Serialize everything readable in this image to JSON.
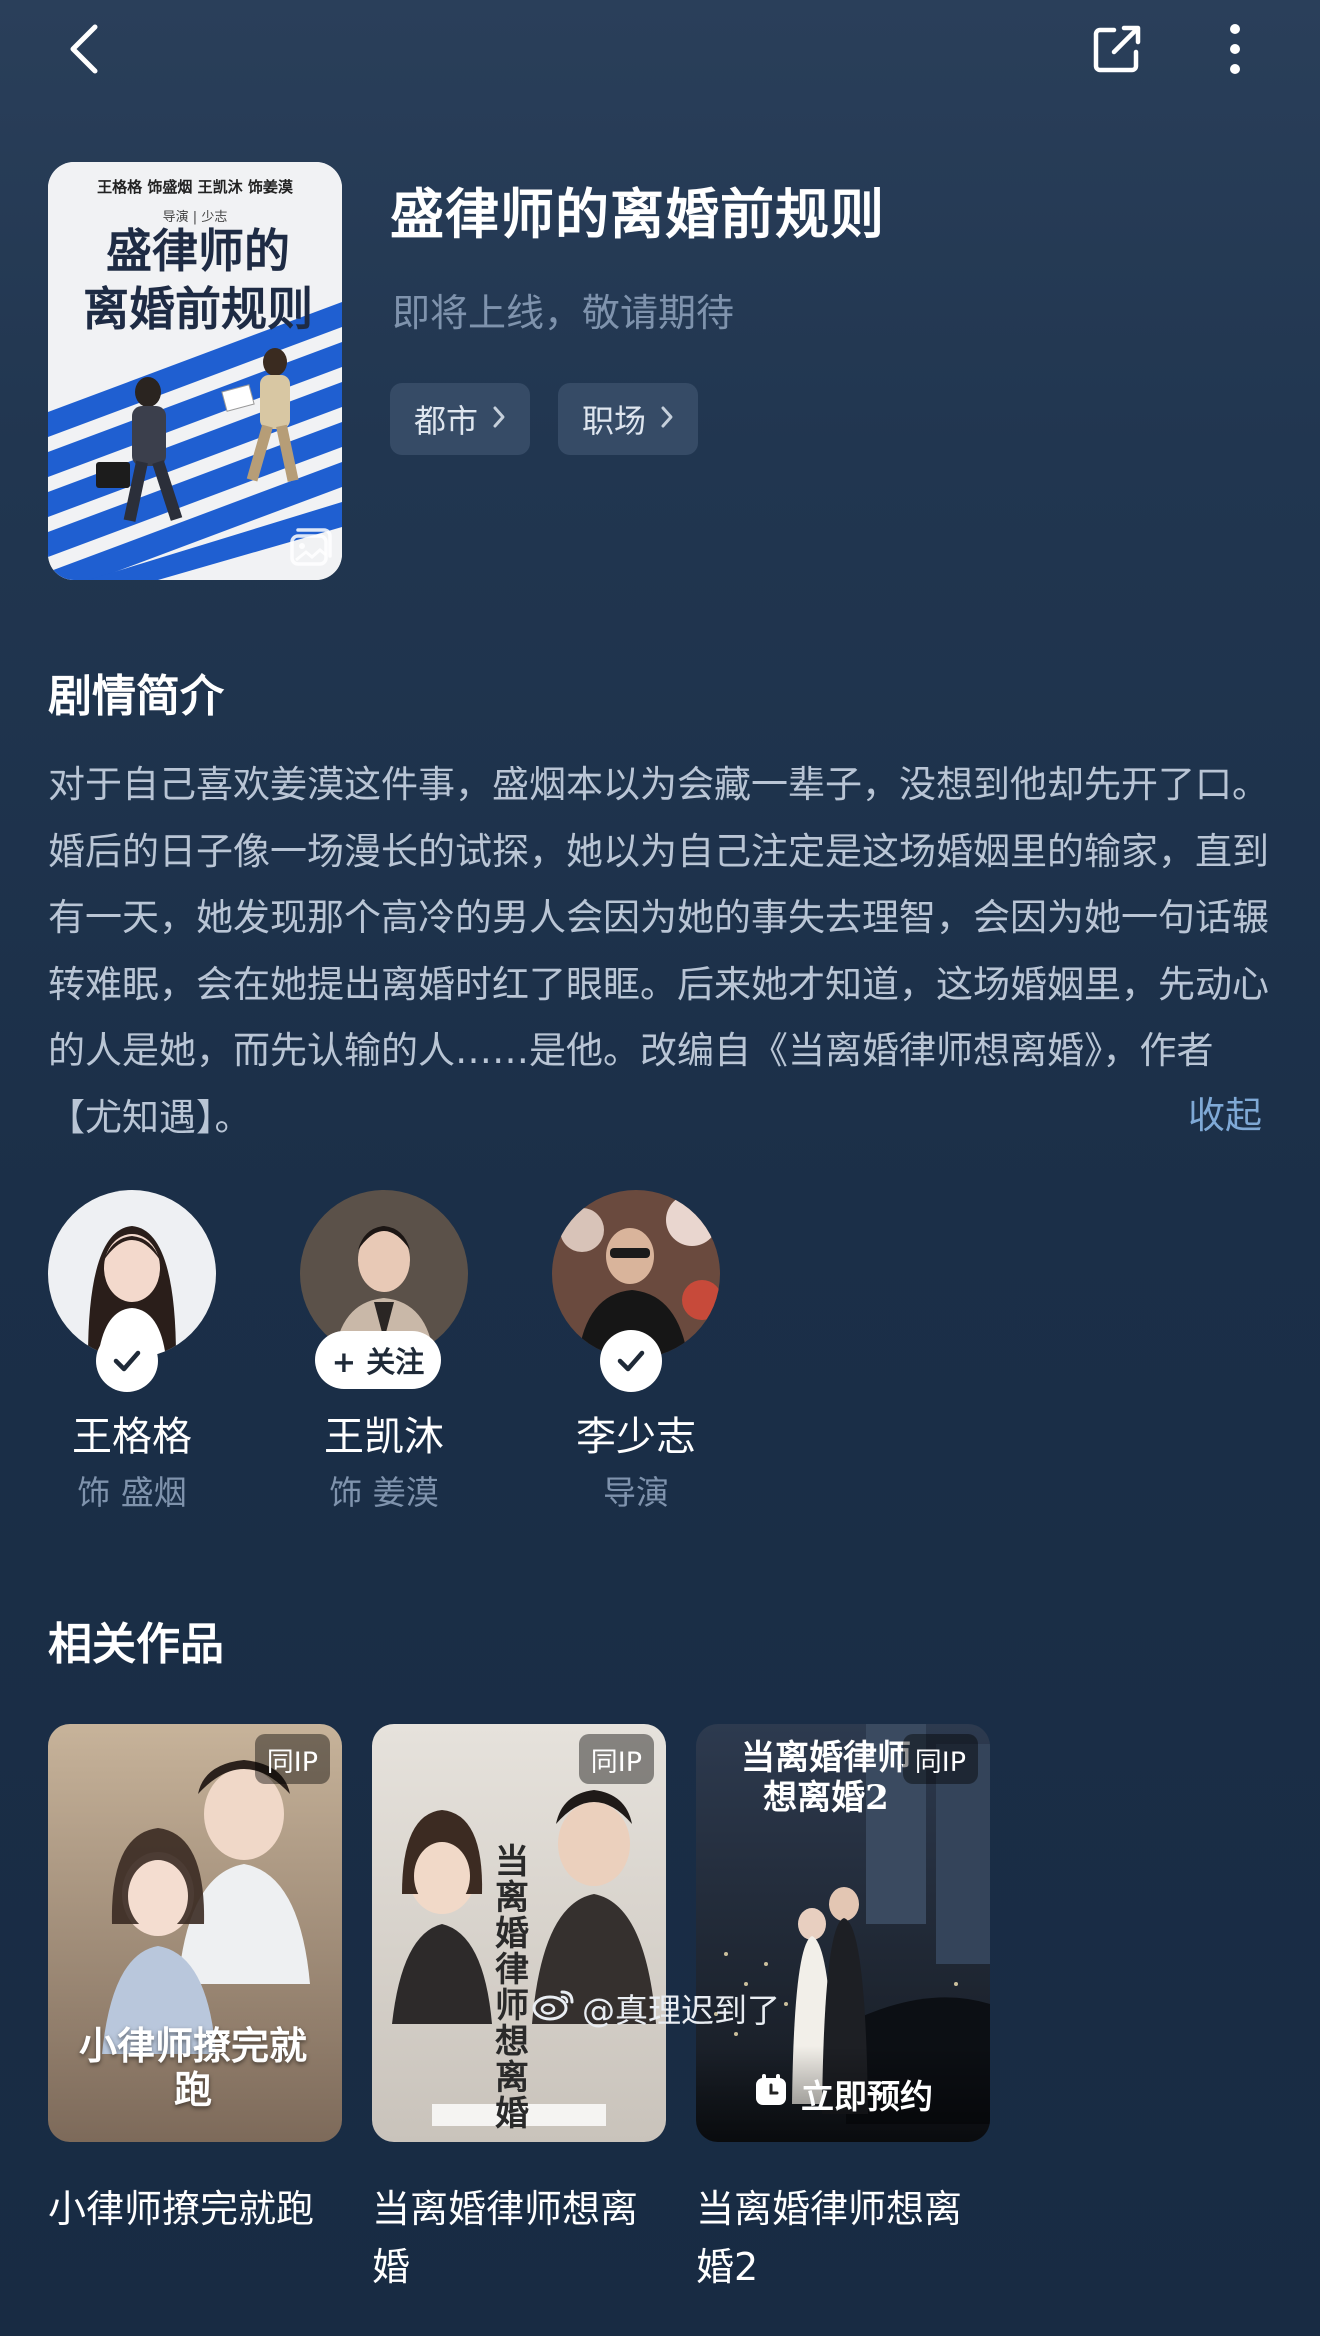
{
  "header": {
    "title": "盛律师的离婚前规则",
    "status": "即将上线，敬请期待",
    "tags": [
      {
        "label": "都市"
      },
      {
        "label": "职场"
      }
    ],
    "poster": {
      "credits": "王格格 饰盛烟   王凯沐 饰姜漠",
      "director": "导演 | 少志",
      "title_line1": "盛律师的",
      "title_line2": "离婚前规则"
    }
  },
  "synopsis": {
    "title": "剧情简介",
    "text": "对于自己喜欢姜漠这件事，盛烟本以为会藏一辈子，没想到他却先开了口。婚后的日子像一场漫长的试探，她以为自己注定是这场婚姻里的输家，直到有一天，她发现那个高冷的男人会因为她的事失去理智，会因为她一句话辗转难眠，会在她提出离婚时红了眼眶。后来她才知道，这场婚姻里，先动心的人是她，而先认输的人……是他。改编自《当离婚律师想离婚》，作者【尤知遇】。",
    "collapse_label": "收起"
  },
  "cast": [
    {
      "name": "王格格",
      "role": "饰 盛烟",
      "badge": "followed"
    },
    {
      "name": "王凯沐",
      "role": "饰 姜漠",
      "badge": "follow",
      "follow_label": "+ 关注"
    },
    {
      "name": "李少志",
      "role": "导演",
      "badge": "followed"
    }
  ],
  "related": {
    "title": "相关作品",
    "items": [
      {
        "title": "小律师撩完就跑",
        "tag": "同IP",
        "poster_text": "小律师撩完就跑"
      },
      {
        "title": "当离婚律师想离婚",
        "tag": "同IP",
        "poster_text": "当离婚律师想离婚"
      },
      {
        "title": "当离婚律师想离婚2",
        "tag": "同IP",
        "poster_text": "当离婚律师想离婚2",
        "action": "立即预约"
      }
    ]
  },
  "watermark": "@真理迟到了",
  "colors": {
    "background": "#1b2d44",
    "tag_bg": "#364b66",
    "link": "#7fa9d6",
    "muted": "#7f93ad"
  }
}
